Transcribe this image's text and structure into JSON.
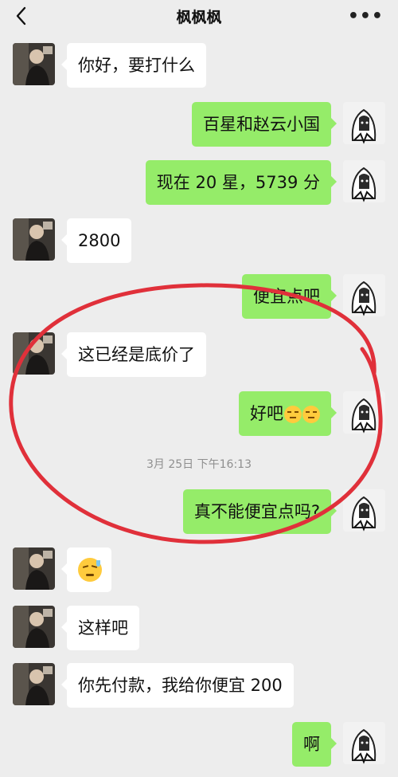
{
  "header": {
    "title": "枫枫枫",
    "back_icon": "chevron-left-icon",
    "more_icon": "more-dots-icon",
    "more_glyph": "•••"
  },
  "messages": [
    {
      "side": "left",
      "text": "你好，要打什么"
    },
    {
      "side": "right",
      "text": "百星和赵云小国"
    },
    {
      "side": "right",
      "text": "现在 20 星，5739 分"
    },
    {
      "side": "left",
      "text": "2800"
    },
    {
      "side": "right",
      "text": "便宜点吧"
    },
    {
      "side": "left",
      "text": "这已经是底价了"
    },
    {
      "side": "right",
      "text": "好吧",
      "emoji": "sweat-expressionless-emoji"
    },
    {
      "side": "right",
      "text": "真不能便宜点吗?"
    },
    {
      "side": "left",
      "text": "",
      "emoji": "sweat-smile-emoji"
    },
    {
      "side": "left",
      "text": "这样吧"
    },
    {
      "side": "left",
      "text": "你先付款，我给你便宜 200"
    },
    {
      "side": "right",
      "text": "啊"
    }
  ],
  "timestamp": "3月 25日 下午16:13",
  "annotation": {
    "type": "red-oval-highlight",
    "color": "#e0303a"
  },
  "colors": {
    "background": "#ededed",
    "sent_bubble": "#95ec69",
    "received_bubble": "#ffffff"
  }
}
